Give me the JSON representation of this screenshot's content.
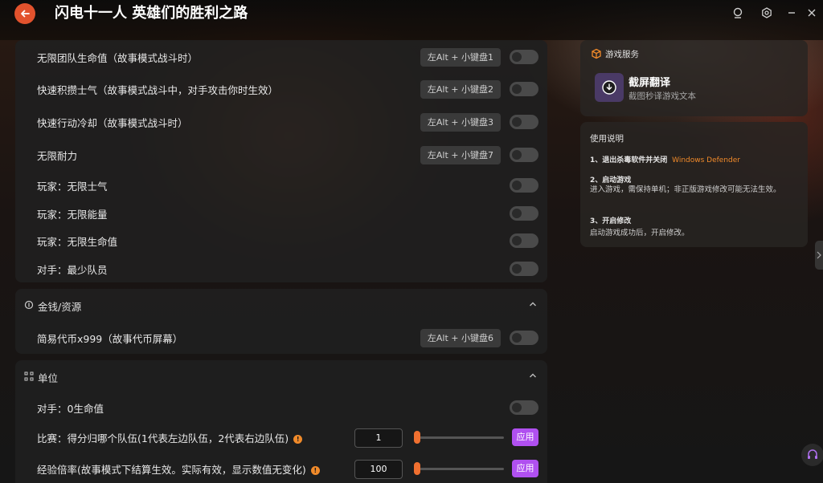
{
  "app": {
    "title": "闪电十一人 英雄们的胜利之路"
  },
  "cheats_top": [
    {
      "label": "无限团队生命值（故事模式战斗时）",
      "hotkey": "左Alt + 小键盘1"
    },
    {
      "label": "快速积攒士气（故事模式战斗中，对手攻击你时生效）",
      "hotkey": "左Alt + 小键盘2"
    },
    {
      "label": "快速行动冷却（故事模式战斗时）",
      "hotkey": "左Alt + 小键盘3"
    },
    {
      "label": "无限耐力",
      "hotkey": "左Alt + 小键盘7"
    },
    {
      "label": "玩家：无限士气",
      "hotkey": ""
    },
    {
      "label": "玩家：无限能量",
      "hotkey": ""
    },
    {
      "label": "玩家：无限生命值",
      "hotkey": ""
    },
    {
      "label": "对手：最少队员",
      "hotkey": ""
    }
  ],
  "money_section": {
    "title": "金钱/资源",
    "items": [
      {
        "label": "简易代币x999（故事代币屏幕）",
        "hotkey": "左Alt + 小键盘6"
      }
    ]
  },
  "unit_section": {
    "title": "单位",
    "toggle_item": {
      "label": "对手：0生命值"
    },
    "value_items": [
      {
        "label": "比赛：得分归哪个队伍(1代表左边队伍，2代表右边队伍)",
        "value": "1",
        "apply_label": "应用"
      },
      {
        "label": "经验倍率(故事模式下结算生效。实际有效，显示数值无变化)",
        "value": "100",
        "apply_label": "应用"
      }
    ]
  },
  "game_service": {
    "heading": "游戏服务",
    "item_title": "截屏翻译",
    "item_desc": "截图秒译游戏文本"
  },
  "instructions": {
    "heading": "使用说明",
    "step1_title": "1、退出杀毒软件并关闭",
    "step1_highlight": "Windows Defender",
    "step2_title": "2、启动游戏",
    "step2_body": "进入游戏，需保持单机；非正版游戏修改可能无法生效。",
    "step3_title": "3、开启修改",
    "step3_body": "启动游戏成功后，开启修改。"
  },
  "colors": {
    "accent_orange": "#e2522d",
    "apply_purple": "#b050f0",
    "highlight_orange": "#f08a2a"
  }
}
